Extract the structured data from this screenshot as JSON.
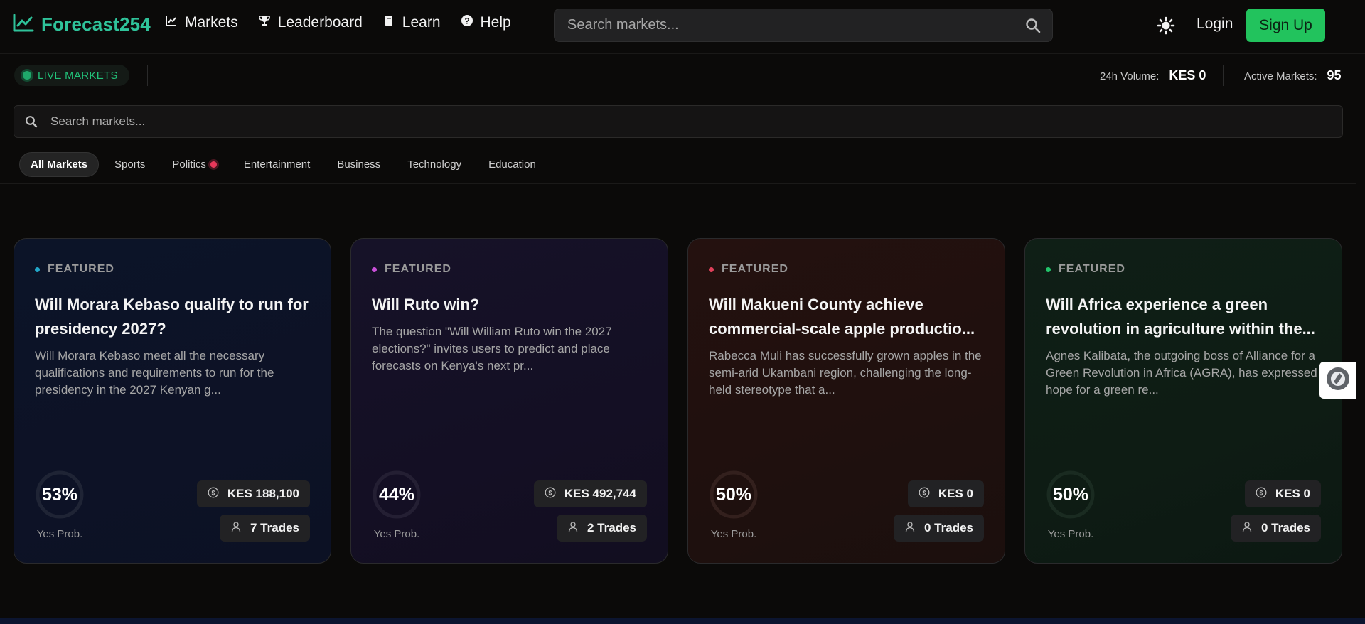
{
  "brand": {
    "name": "Forecast254",
    "color": "#2fc39a"
  },
  "nav": {
    "links": [
      {
        "label": "Markets",
        "icon": "chart-icon"
      },
      {
        "label": "Leaderboard",
        "icon": "trophy-icon"
      },
      {
        "label": "Learn",
        "icon": "book-icon"
      },
      {
        "label": "Help",
        "icon": "question-icon"
      }
    ],
    "search_placeholder": "Search markets...",
    "login": "Login",
    "signup": "Sign Up",
    "signup_color": "#22c35d"
  },
  "livebar": {
    "live_label": "LIVE MARKETS",
    "volume_label": "24h Volume:",
    "volume_value": "KES 0",
    "active_label": "Active Markets:",
    "active_value": "95"
  },
  "search": {
    "placeholder": "Search markets..."
  },
  "categories": [
    {
      "label": "All Markets",
      "active": true
    },
    {
      "label": "Sports"
    },
    {
      "label": "Politics",
      "badge": true
    },
    {
      "label": "Entertainment"
    },
    {
      "label": "Business"
    },
    {
      "label": "Technology"
    },
    {
      "label": "Education"
    }
  ],
  "cards": [
    {
      "featured": "FEATURED",
      "accent": "#22a6c8",
      "title": "Will Morara Kebaso qualify to run for presidency 2027?",
      "description": "Will Morara Kebaso meet all the necessary qualifications and requirements to run for the presidency in the 2027 Kenyan g...",
      "probability": "53%",
      "probability_value": 0.53,
      "prob_label": "Yes Prob.",
      "volume": "KES 188,100",
      "trades": "7 Trades"
    },
    {
      "featured": "FEATURED",
      "accent": "#c84fd8",
      "title": "Will Ruto win?",
      "description": "The question \"Will William Ruto win the 2027 elections?\" invites users to predict and place forecasts on Kenya's next pr...",
      "probability": "44%",
      "probability_value": 0.44,
      "prob_label": "Yes Prob.",
      "volume": "KES 492,744",
      "trades": "2 Trades"
    },
    {
      "featured": "FEATURED",
      "accent": "#e0405a",
      "title": "Will Makueni County achieve commercial-scale apple productio...",
      "description": "Rabecca Muli has successfully grown apples in the semi-arid Ukambani region, challenging the long-held stereotype that a...",
      "probability": "50%",
      "probability_value": 0.5,
      "prob_label": "Yes Prob.",
      "volume": "KES 0",
      "trades": "0 Trades"
    },
    {
      "featured": "FEATURED",
      "accent": "#22c36a",
      "title": "Will Africa experience a green revolution in agriculture within the...",
      "description": "Agnes Kalibata, the outgoing boss of Alliance for a Green Revolution in Africa (AGRA), has expressed hope for a green re...",
      "probability": "50%",
      "probability_value": 0.5,
      "prob_label": "Yes Prob.",
      "volume": "KES 0",
      "trades": "0 Trades"
    }
  ]
}
